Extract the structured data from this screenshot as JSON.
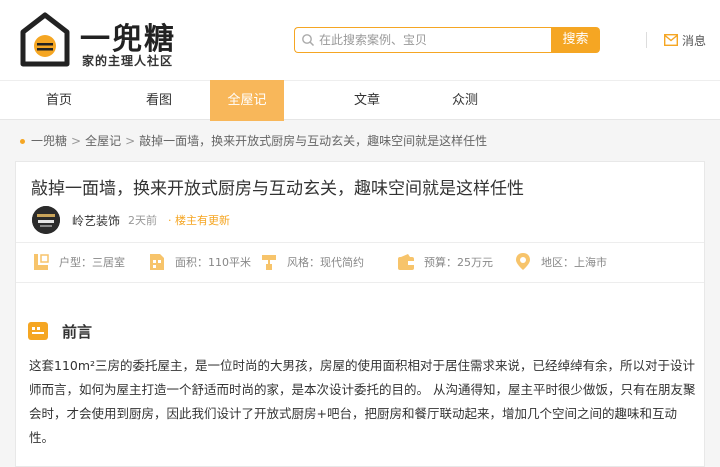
{
  "header": {
    "brand_name": "一兜糖",
    "brand_slogan": "家的主理人社区",
    "search_placeholder": "在此搜索案例、宝贝",
    "search_button": "搜索",
    "messages_label": "消息"
  },
  "nav": {
    "items": [
      {
        "label": "首页"
      },
      {
        "label": "看图"
      },
      {
        "label": "全屋记"
      },
      {
        "label": "文章"
      },
      {
        "label": "众测"
      }
    ],
    "active_index": 2
  },
  "breadcrumb": {
    "items": [
      "一兜糖",
      "全屋记",
      "敲掉一面墙，换来开放式厨房与互动玄关，趣味空间就是这样任性"
    ],
    "separator": ">"
  },
  "article": {
    "title": "敲掉一面墙，换来开放式厨房与互动玄关，趣味空间就是这样任性",
    "author": "岭艺装饰",
    "time": "2天前",
    "update_status": "· 楼主有更新",
    "info": [
      {
        "icon": "layout-icon",
        "text": "户型：三居室"
      },
      {
        "icon": "area-icon",
        "text": "面积：110平米"
      },
      {
        "icon": "style-icon",
        "text": "风格：现代简约"
      },
      {
        "icon": "budget-icon",
        "text": "预算：25万元"
      },
      {
        "icon": "location-icon",
        "text": "地区：上海市"
      }
    ],
    "section_title": "前言",
    "body": "这套110m²三房的委托屋主，是一位时尚的大男孩，房屋的使用面积相对于居住需求来说，已经绰绰有余，所以对于设计师而言，如何为屋主打造一个舒适而时尚的家，是本次设计委托的目的。 从沟通得知，屋主平时很少做饭，只有在朋友聚会时，才会使用到厨房，因此我们设计了开放式厨房+吧台，把厨房和餐厅联动起来，增加几个空间之间的趣味和互动性。"
  },
  "colors": {
    "accent": "#f5a623",
    "nav_active": "#f8b75a"
  }
}
